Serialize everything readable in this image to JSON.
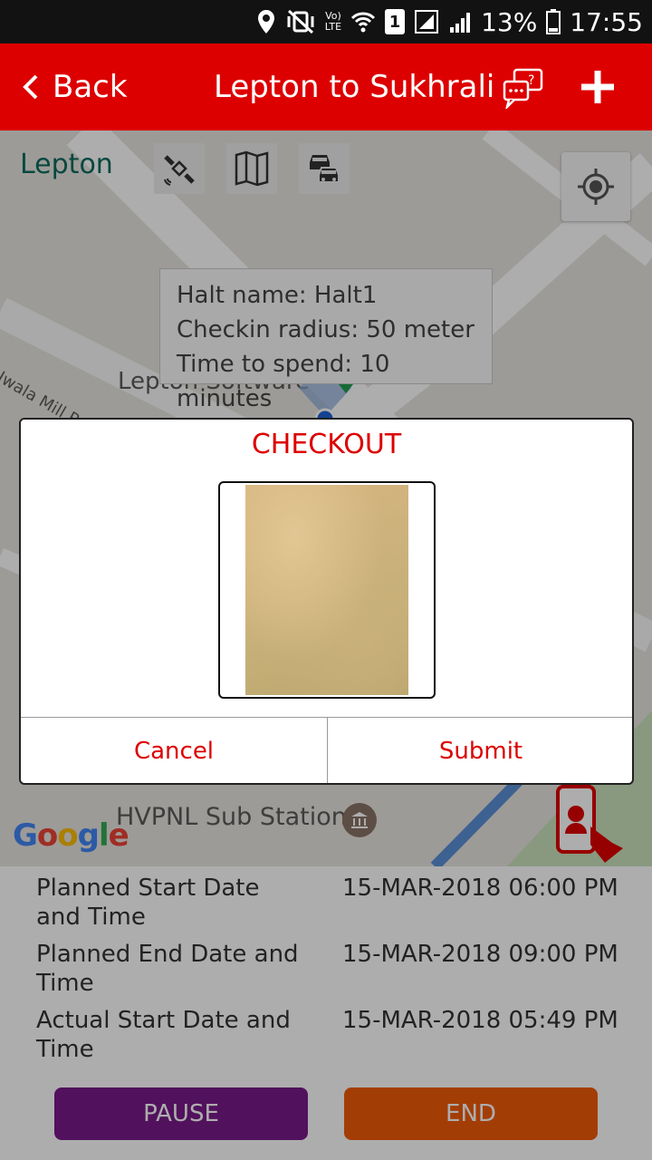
{
  "status_bar": {
    "battery": "13%",
    "time": "17:55",
    "sim_slot": "1",
    "network_label": "LTE",
    "icons": [
      "location-icon",
      "vibrate-icon",
      "volte-icon",
      "wifi-icon",
      "sim-icon",
      "signal-icon",
      "battery-icon"
    ]
  },
  "app_bar": {
    "back_label": "Back",
    "title": "Lepton to Sukhrali",
    "background": "#dd0000"
  },
  "map": {
    "logo_text": "Lepton",
    "halt_info": {
      "name": "Halt name: Halt1",
      "radius": "Checkin radius: 50 meter",
      "time": "Time to spend: 10 minutes"
    },
    "labels": {
      "jwala_road": "Jwala Mill Rd",
      "lepton_software": "Lepton Software",
      "hvpnl": "HVPNL Sub Station"
    },
    "google": "Google"
  },
  "dialog": {
    "title": "CHECKOUT",
    "cancel_label": "Cancel",
    "submit_label": "Submit"
  },
  "details": [
    {
      "label": "Planned Start Date and Time",
      "value": "15-MAR-2018 06:00 PM"
    },
    {
      "label": "Planned End Date and Time",
      "value": "15-MAR-2018 09:00 PM"
    },
    {
      "label": "Actual Start Date and Time",
      "value": "15-MAR-2018 05:49 PM"
    }
  ],
  "actions": {
    "pause_label": "PAUSE",
    "end_label": "END",
    "pause_color": "#7a1a8a",
    "end_color": "#f05a0a"
  }
}
